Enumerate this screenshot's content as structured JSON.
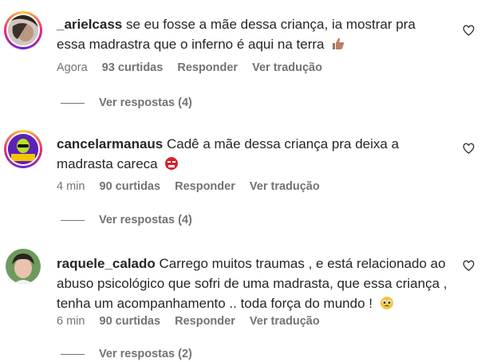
{
  "comments": [
    {
      "username": "_arielcass",
      "text": "se eu fosse a mãe dessa criança, ia mostrar pra essa madrastra que o inferno é aqui na terra",
      "emoji": "thumbs-up",
      "time": "Agora",
      "likes": "93 curtidas",
      "reply": "Responder",
      "translate": "Ver tradução",
      "replies": "Ver respostas (4)"
    },
    {
      "username": "cancelarmanaus",
      "text": "Cadê a mãe dessa criança pra deixa a madrasta careca",
      "emoji": "angry-face",
      "time": "4 min",
      "likes": "90 curtidas",
      "reply": "Responder",
      "translate": "Ver tradução",
      "replies": "Ver respostas (4)",
      "avatar_text": "CANCELAR MANAUS"
    },
    {
      "username": "raquele_calado",
      "text": "Carrego muitos traumas , e está relacionado ao abuso psicológico que sofri de uma madrasta, que essa criança , tenha um acompanhamento .. toda força do mundo !",
      "emoji": "pleading-face",
      "time": "6 min",
      "likes": "90 curtidas",
      "reply": "Responder",
      "translate": "Ver tradução",
      "replies": "Ver respostas (2)"
    }
  ],
  "colors": {
    "text": "#262626",
    "secondary": "#737373",
    "ring_start": "#f9ce34",
    "ring_mid": "#ee2a7b",
    "ring_end": "#6228d7"
  }
}
